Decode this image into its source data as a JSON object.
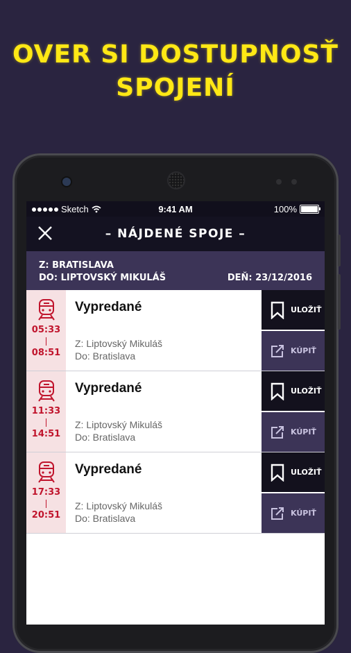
{
  "promo": {
    "headline_line1": "OVER SI DOSTUPNOSŤ",
    "headline_line2": "SPOJENÍ",
    "accent_color": "#ffe815"
  },
  "statusbar": {
    "carrier": "Sketch",
    "time": "9:41 AM",
    "battery": "100%"
  },
  "navbar": {
    "close_icon": "close-icon",
    "title": "– NÁJDENÉ SPOJE –"
  },
  "route": {
    "from": "Z: BRATISLAVA",
    "to": "DO: LIPTOVSKÝ MIKULÁŠ",
    "date": "DEŇ: 23/12/2016"
  },
  "connections": [
    {
      "departure": "05:33",
      "arrival": "08:51",
      "status": "Vypredané",
      "from": "Z: Liptovský Mikuláš",
      "to": "Do: Bratislava",
      "save_label": "ULOŽIŤ",
      "buy_label": "KÚPIŤ"
    },
    {
      "departure": "11:33",
      "arrival": "14:51",
      "status": "Vypredané",
      "from": "Z: Liptovský Mikuláš",
      "to": "Do: Bratislava",
      "save_label": "ULOŽIŤ",
      "buy_label": "KÚPIŤ"
    },
    {
      "departure": "17:33",
      "arrival": "20:51",
      "status": "Vypredané",
      "from": "Z: Liptovský Mikuláš",
      "to": "Do: Bratislava",
      "save_label": "ULOŽIŤ",
      "buy_label": "KÚPIŤ"
    }
  ],
  "colors": {
    "background": "#2a2440",
    "route_bar": "#3c3457",
    "time_red": "#c0142c",
    "time_bg": "#f6e1e3"
  }
}
